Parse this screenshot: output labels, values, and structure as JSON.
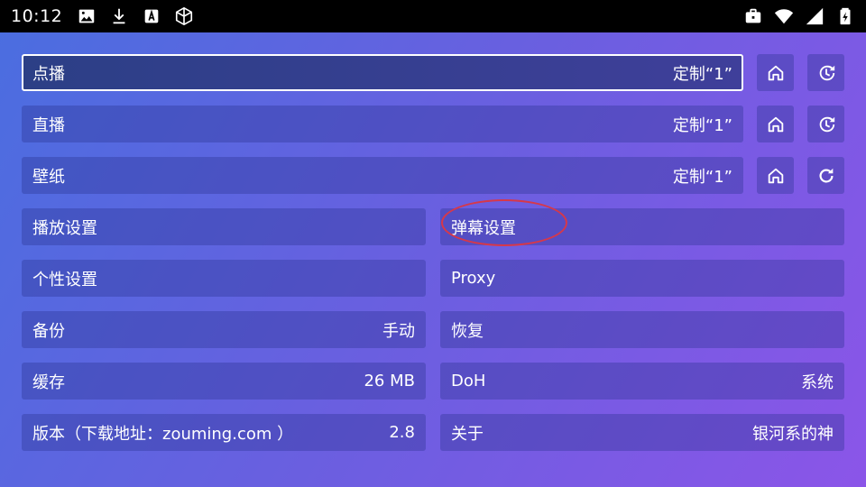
{
  "status_bar": {
    "time": "10:12",
    "left_icons": [
      "image-icon",
      "download-icon",
      "keyboard-a-icon",
      "cube-icon"
    ],
    "right_icons": [
      "briefcase-icon",
      "wifi-icon",
      "signal-icon",
      "battery-icon"
    ]
  },
  "source_rows": [
    {
      "label": "点播",
      "value": "定制“1”",
      "buttons": [
        "home-icon",
        "history-icon"
      ],
      "focused": true
    },
    {
      "label": "直播",
      "value": "定制“1”",
      "buttons": [
        "home-icon",
        "history-icon"
      ],
      "focused": false
    },
    {
      "label": "壁纸",
      "value": "定制“1”",
      "buttons": [
        "home-icon",
        "refresh-icon"
      ],
      "focused": false
    }
  ],
  "grid": [
    {
      "left": {
        "label": "播放设置",
        "value": ""
      },
      "right": {
        "label": "弹幕设置",
        "value": ""
      }
    },
    {
      "left": {
        "label": "个性设置",
        "value": ""
      },
      "right": {
        "label": "Proxy",
        "value": ""
      }
    },
    {
      "left": {
        "label": "备份",
        "value": "手动"
      },
      "right": {
        "label": "恢复",
        "value": ""
      }
    },
    {
      "left": {
        "label": "缓存",
        "value": "26 MB"
      },
      "right": {
        "label": "DoH",
        "value": "系统"
      }
    },
    {
      "left": {
        "label": "版本（下载地址：zouming.com ）",
        "value": "2.8"
      },
      "right": {
        "label": "关于",
        "value": "银河系的神"
      }
    }
  ],
  "colors": {
    "annotation": "#d6384a",
    "gradient_start": "#4a6ee0",
    "gradient_end": "#8b55e8"
  }
}
